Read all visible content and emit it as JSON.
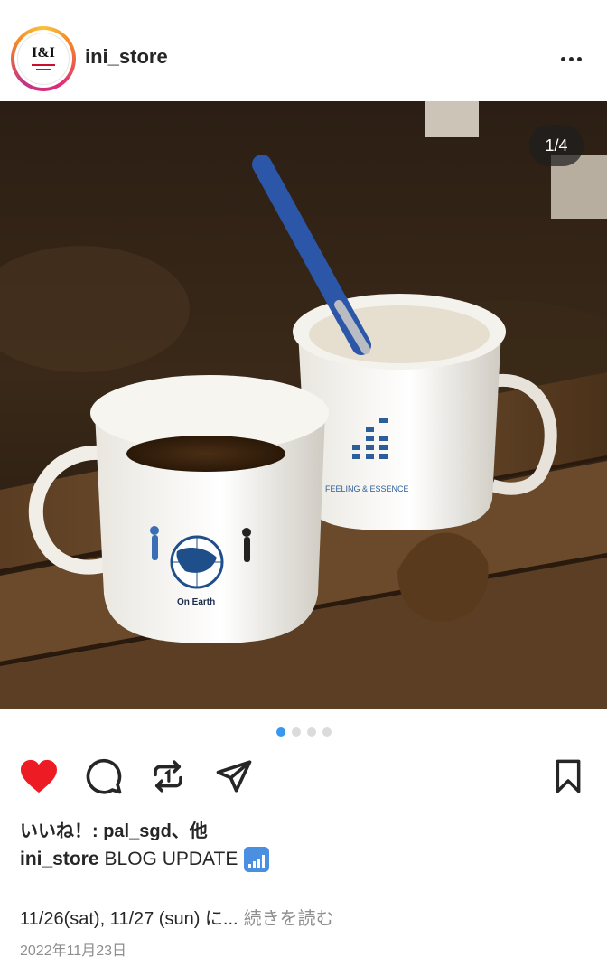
{
  "header": {
    "avatar_text": "I&I",
    "username": "ini_store",
    "more_label": "more options"
  },
  "photo": {
    "counter": "1/4",
    "mug_left_label": "On Earth",
    "mug_right_label": "FEELING & ESSENCE"
  },
  "carousel": {
    "count": 4,
    "active": 1
  },
  "actions": {
    "like_icon": "heart-icon",
    "comment_icon": "comment-icon",
    "repost_icon": "repost-icon",
    "share_icon": "send-icon",
    "save_icon": "bookmark-icon",
    "like_color": "#ed1c24"
  },
  "likes": {
    "text": "いいね！: pal_sgd、他"
  },
  "caption": {
    "username": "ini_store",
    "text": "BLOG UPDATE",
    "emoji": "signal-bars-icon"
  },
  "snippet": {
    "text": "11/26(sat), 11/27 (sun) に...",
    "more": "続きを読む"
  },
  "date": "2022年11月23日"
}
